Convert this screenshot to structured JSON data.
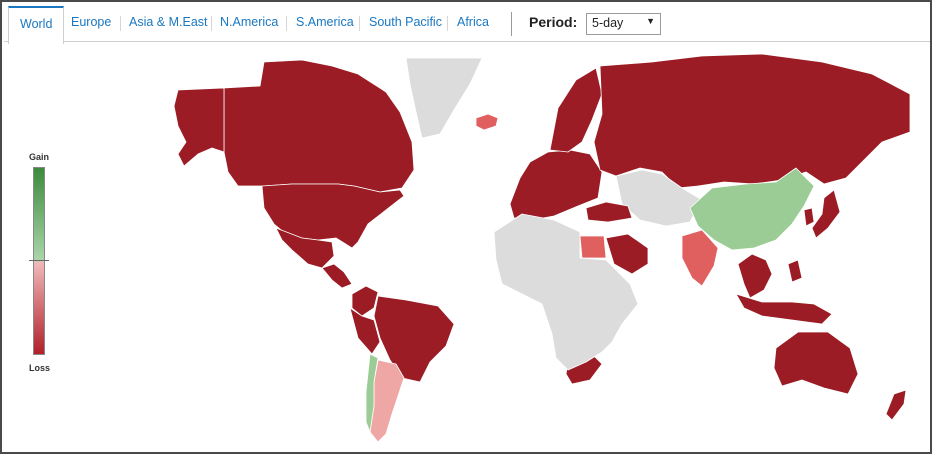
{
  "tabs": [
    {
      "label": "World",
      "active": true
    },
    {
      "label": "Europe",
      "active": false
    },
    {
      "label": "Asia & M.East",
      "active": false
    },
    {
      "label": "N.America",
      "active": false
    },
    {
      "label": "S.America",
      "active": false
    },
    {
      "label": "South Pacific",
      "active": false
    },
    {
      "label": "Africa",
      "active": false
    }
  ],
  "period": {
    "label": "Period:",
    "selected": "5-day"
  },
  "legend": {
    "top_label": "Gain",
    "bottom_label": "Loss"
  },
  "colors": {
    "accent": "#1a78c2",
    "strong_loss": "#9b1c24",
    "moderate_loss": "#e06060",
    "mild_loss": "#efa7a5",
    "mild_gain": "#9ccc95",
    "no_data": "#dcdcdc"
  },
  "map": {
    "regions": [
      {
        "name": "Canada",
        "status": "strong_loss"
      },
      {
        "name": "Alaska",
        "status": "strong_loss"
      },
      {
        "name": "United States",
        "status": "strong_loss"
      },
      {
        "name": "Mexico",
        "status": "strong_loss"
      },
      {
        "name": "Central America",
        "status": "strong_loss"
      },
      {
        "name": "Greenland",
        "status": "no_data"
      },
      {
        "name": "Iceland",
        "status": "moderate_loss"
      },
      {
        "name": "Brazil",
        "status": "strong_loss"
      },
      {
        "name": "Colombia",
        "status": "strong_loss"
      },
      {
        "name": "Peru",
        "status": "strong_loss"
      },
      {
        "name": "Argentina",
        "status": "mild_loss"
      },
      {
        "name": "Chile",
        "status": "mild_gain"
      },
      {
        "name": "Europe",
        "status": "strong_loss"
      },
      {
        "name": "Norway and Sweden",
        "status": "strong_loss"
      },
      {
        "name": "Russia",
        "status": "strong_loss"
      },
      {
        "name": "Kazakhstan and Central Asia",
        "status": "no_data"
      },
      {
        "name": "Turkey",
        "status": "strong_loss"
      },
      {
        "name": "Saudi Arabia",
        "status": "strong_loss"
      },
      {
        "name": "Egypt",
        "status": "moderate_loss"
      },
      {
        "name": "Nigeria",
        "status": "moderate_loss"
      },
      {
        "name": "Kenya",
        "status": "strong_loss"
      },
      {
        "name": "South Africa",
        "status": "strong_loss"
      },
      {
        "name": "Rest of Africa",
        "status": "no_data"
      },
      {
        "name": "India",
        "status": "moderate_loss"
      },
      {
        "name": "China",
        "status": "mild_gain"
      },
      {
        "name": "Japan",
        "status": "strong_loss"
      },
      {
        "name": "South Korea",
        "status": "strong_loss"
      },
      {
        "name": "Southeast Asia",
        "status": "strong_loss"
      },
      {
        "name": "Indonesia",
        "status": "strong_loss"
      },
      {
        "name": "Philippines",
        "status": "strong_loss"
      },
      {
        "name": "Australia",
        "status": "strong_loss"
      },
      {
        "name": "New Zealand",
        "status": "strong_loss"
      }
    ]
  }
}
